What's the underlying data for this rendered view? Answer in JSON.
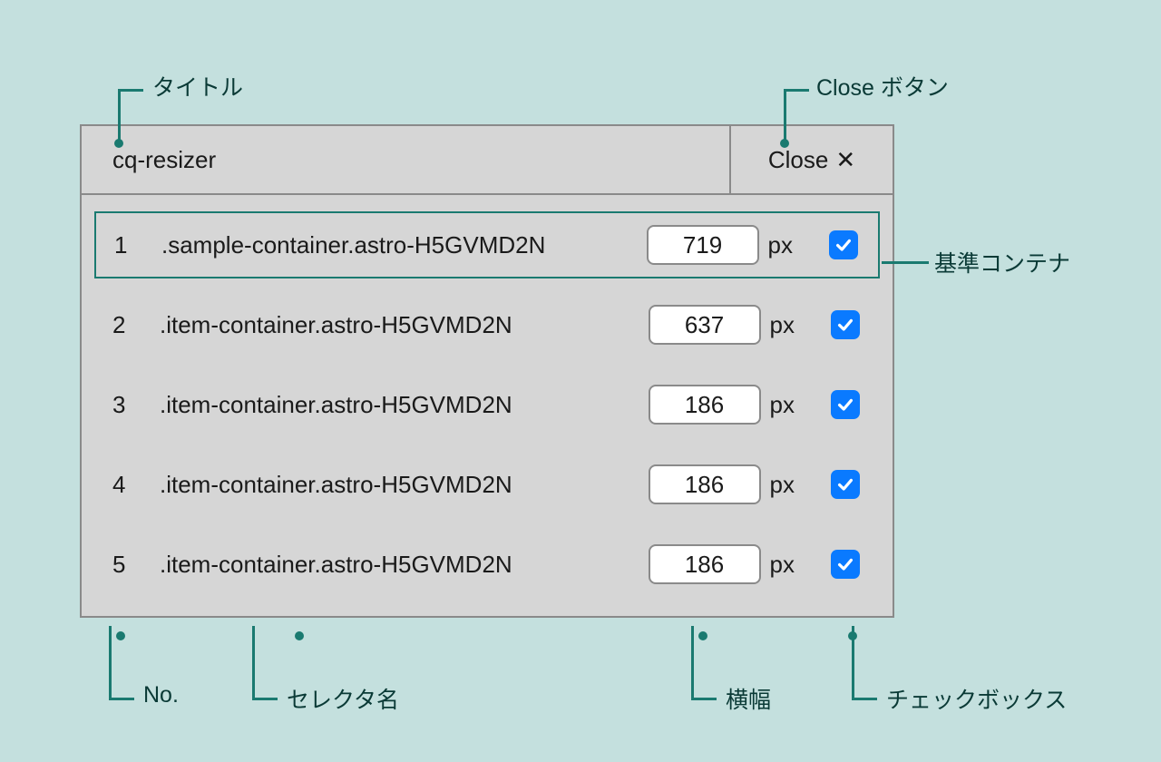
{
  "annotations": {
    "title": "タイトル",
    "close_button": "Close ボタン",
    "base_container": "基準コンテナ",
    "no": "No.",
    "selector_name": "セレクタ名",
    "width": "横幅",
    "checkbox": "チェックボックス"
  },
  "panel": {
    "title": "cq-resizer",
    "close_label": "Close",
    "px_unit": "px",
    "rows": [
      {
        "no": "1",
        "selector": ".sample-container.astro-H5GVMD2N",
        "width": "719",
        "checked": true,
        "highlight": true
      },
      {
        "no": "2",
        "selector": ".item-container.astro-H5GVMD2N",
        "width": "637",
        "checked": true,
        "highlight": false
      },
      {
        "no": "3",
        "selector": ".item-container.astro-H5GVMD2N",
        "width": "186",
        "checked": true,
        "highlight": false
      },
      {
        "no": "4",
        "selector": ".item-container.astro-H5GVMD2N",
        "width": "186",
        "checked": true,
        "highlight": false
      },
      {
        "no": "5",
        "selector": ".item-container.astro-H5GVMD2N",
        "width": "186",
        "checked": true,
        "highlight": false
      }
    ]
  }
}
